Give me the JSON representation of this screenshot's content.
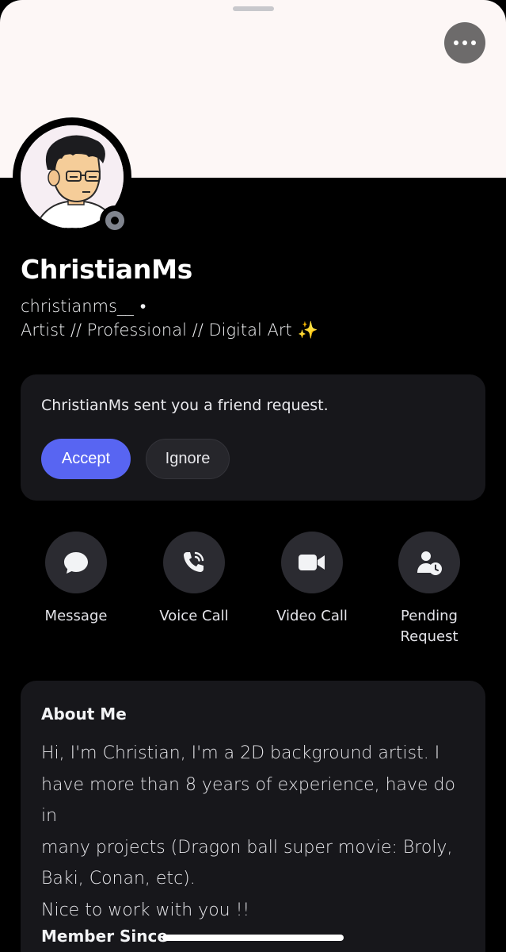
{
  "profile": {
    "display_name": "ChristianMs",
    "username": "christianms__",
    "separator": "•",
    "bio": "Artist //  Professional // Digital Art",
    "bio_emoji": "✨",
    "status": "offline"
  },
  "friend_request": {
    "message": "ChristianMs sent you a friend request.",
    "accept_label": "Accept",
    "ignore_label": "Ignore"
  },
  "actions": [
    {
      "label": "Message",
      "icon": "chat-bubble-icon"
    },
    {
      "label": "Voice Call",
      "icon": "phone-icon"
    },
    {
      "label": "Video Call",
      "icon": "video-camera-icon"
    },
    {
      "label": "Pending Request",
      "icon": "pending-user-icon"
    }
  ],
  "about": {
    "title": "About Me",
    "lines": [
      "Hi, I'm Christian, I'm a 2D background artist. I",
      "have more than 8 years of experience, have do in",
      "many projects (Dragon ball super movie: Broly,",
      "Baki, Conan, etc).",
      "Nice to work with you !!"
    ],
    "member_since_title": "Member Since"
  },
  "colors": {
    "accent": "#5865f2",
    "banner": "#fdf7f6",
    "card": "#17171b",
    "status_offline": "#80848e"
  }
}
